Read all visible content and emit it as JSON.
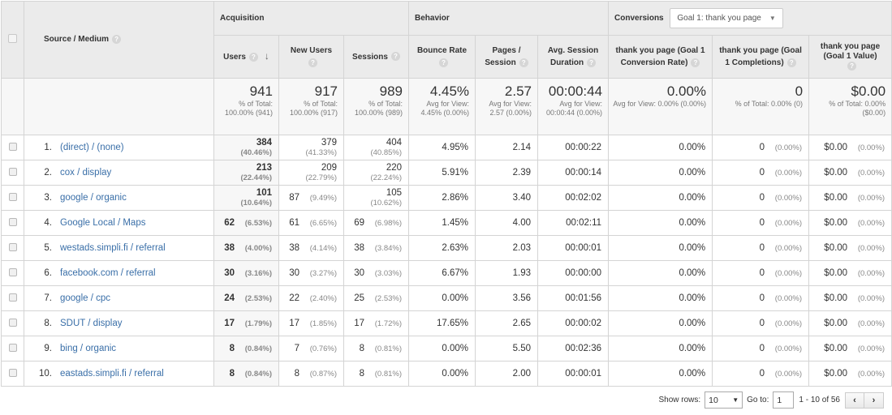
{
  "header": {
    "source_medium": "Source / Medium",
    "groups": {
      "acquisition": "Acquisition",
      "behavior": "Behavior",
      "conversions": "Conversions"
    },
    "goal_selector": "Goal 1: thank you page",
    "columns": {
      "users": "Users",
      "new_users": "New Users",
      "sessions": "Sessions",
      "bounce_rate": "Bounce Rate",
      "pages_session": "Pages / Session",
      "avg_duration": "Avg. Session Duration",
      "conv_rate": "thank you page (Goal 1 Conversion Rate)",
      "completions": "thank you page (Goal 1 Completions)",
      "value": "thank you page (Goal 1 Value)"
    },
    "help_icon": "?",
    "sort_icon": "↓"
  },
  "totals": {
    "users": {
      "value": "941",
      "sub": "% of Total: 100.00% (941)"
    },
    "new_users": {
      "value": "917",
      "sub": "% of Total: 100.00% (917)"
    },
    "sessions": {
      "value": "989",
      "sub": "% of Total: 100.00% (989)"
    },
    "bounce_rate": {
      "value": "4.45%",
      "sub": "Avg for View: 4.45% (0.00%)"
    },
    "pages_session": {
      "value": "2.57",
      "sub": "Avg for View: 2.57 (0.00%)"
    },
    "avg_duration": {
      "value": "00:00:44",
      "sub": "Avg for View: 00:00:44 (0.00%)"
    },
    "conv_rate": {
      "value": "0.00%",
      "sub": "Avg for View: 0.00% (0.00%)"
    },
    "completions": {
      "value": "0",
      "sub": "% of Total: 0.00% (0)"
    },
    "value": {
      "value": "$0.00",
      "sub": "% of Total: 0.00% ($0.00)"
    }
  },
  "rows": [
    {
      "idx": "1.",
      "source": "(direct) / (none)",
      "users": "384",
      "users_pct": "(40.46%)",
      "new_users": "379",
      "new_users_pct": "(41.33%)",
      "sessions": "404",
      "sessions_pct": "(40.85%)",
      "bounce": "4.95%",
      "pages": "2.14",
      "duration": "00:00:22",
      "conv": "0.00%",
      "comp": "0",
      "comp_pct": "(0.00%)",
      "val": "$0.00",
      "val_pct": "(0.00%)"
    },
    {
      "idx": "2.",
      "source": "cox / display",
      "users": "213",
      "users_pct": "(22.44%)",
      "new_users": "209",
      "new_users_pct": "(22.79%)",
      "sessions": "220",
      "sessions_pct": "(22.24%)",
      "bounce": "5.91%",
      "pages": "2.39",
      "duration": "00:00:14",
      "conv": "0.00%",
      "comp": "0",
      "comp_pct": "(0.00%)",
      "val": "$0.00",
      "val_pct": "(0.00%)"
    },
    {
      "idx": "3.",
      "source": "google / organic",
      "users": "101",
      "users_pct": "(10.64%)",
      "new_users": "87",
      "new_users_pct": "(9.49%)",
      "sessions": "105",
      "sessions_pct": "(10.62%)",
      "bounce": "2.86%",
      "pages": "3.40",
      "duration": "00:02:02",
      "conv": "0.00%",
      "comp": "0",
      "comp_pct": "(0.00%)",
      "val": "$0.00",
      "val_pct": "(0.00%)"
    },
    {
      "idx": "4.",
      "source": "Google Local / Maps",
      "users": "62",
      "users_pct": "(6.53%)",
      "new_users": "61",
      "new_users_pct": "(6.65%)",
      "sessions": "69",
      "sessions_pct": "(6.98%)",
      "bounce": "1.45%",
      "pages": "4.00",
      "duration": "00:02:11",
      "conv": "0.00%",
      "comp": "0",
      "comp_pct": "(0.00%)",
      "val": "$0.00",
      "val_pct": "(0.00%)"
    },
    {
      "idx": "5.",
      "source": "westads.simpli.fi / referral",
      "users": "38",
      "users_pct": "(4.00%)",
      "new_users": "38",
      "new_users_pct": "(4.14%)",
      "sessions": "38",
      "sessions_pct": "(3.84%)",
      "bounce": "2.63%",
      "pages": "2.03",
      "duration": "00:00:01",
      "conv": "0.00%",
      "comp": "0",
      "comp_pct": "(0.00%)",
      "val": "$0.00",
      "val_pct": "(0.00%)"
    },
    {
      "idx": "6.",
      "source": "facebook.com / referral",
      "users": "30",
      "users_pct": "(3.16%)",
      "new_users": "30",
      "new_users_pct": "(3.27%)",
      "sessions": "30",
      "sessions_pct": "(3.03%)",
      "bounce": "6.67%",
      "pages": "1.93",
      "duration": "00:00:00",
      "conv": "0.00%",
      "comp": "0",
      "comp_pct": "(0.00%)",
      "val": "$0.00",
      "val_pct": "(0.00%)"
    },
    {
      "idx": "7.",
      "source": "google / cpc",
      "users": "24",
      "users_pct": "(2.53%)",
      "new_users": "22",
      "new_users_pct": "(2.40%)",
      "sessions": "25",
      "sessions_pct": "(2.53%)",
      "bounce": "0.00%",
      "pages": "3.56",
      "duration": "00:01:56",
      "conv": "0.00%",
      "comp": "0",
      "comp_pct": "(0.00%)",
      "val": "$0.00",
      "val_pct": "(0.00%)"
    },
    {
      "idx": "8.",
      "source": "SDUT / display",
      "users": "17",
      "users_pct": "(1.79%)",
      "new_users": "17",
      "new_users_pct": "(1.85%)",
      "sessions": "17",
      "sessions_pct": "(1.72%)",
      "bounce": "17.65%",
      "pages": "2.65",
      "duration": "00:00:02",
      "conv": "0.00%",
      "comp": "0",
      "comp_pct": "(0.00%)",
      "val": "$0.00",
      "val_pct": "(0.00%)"
    },
    {
      "idx": "9.",
      "source": "bing / organic",
      "users": "8",
      "users_pct": "(0.84%)",
      "new_users": "7",
      "new_users_pct": "(0.76%)",
      "sessions": "8",
      "sessions_pct": "(0.81%)",
      "bounce": "0.00%",
      "pages": "5.50",
      "duration": "00:02:36",
      "conv": "0.00%",
      "comp": "0",
      "comp_pct": "(0.00%)",
      "val": "$0.00",
      "val_pct": "(0.00%)"
    },
    {
      "idx": "10.",
      "source": "eastads.simpli.fi / referral",
      "users": "8",
      "users_pct": "(0.84%)",
      "new_users": "8",
      "new_users_pct": "(0.87%)",
      "sessions": "8",
      "sessions_pct": "(0.81%)",
      "bounce": "0.00%",
      "pages": "2.00",
      "duration": "00:00:01",
      "conv": "0.00%",
      "comp": "0",
      "comp_pct": "(0.00%)",
      "val": "$0.00",
      "val_pct": "(0.00%)"
    }
  ],
  "footer": {
    "show_rows_label": "Show rows:",
    "show_rows_value": "10",
    "goto_label": "Go to:",
    "goto_value": "1",
    "range": "1 - 10 of 56",
    "prev": "‹",
    "next": "›"
  }
}
